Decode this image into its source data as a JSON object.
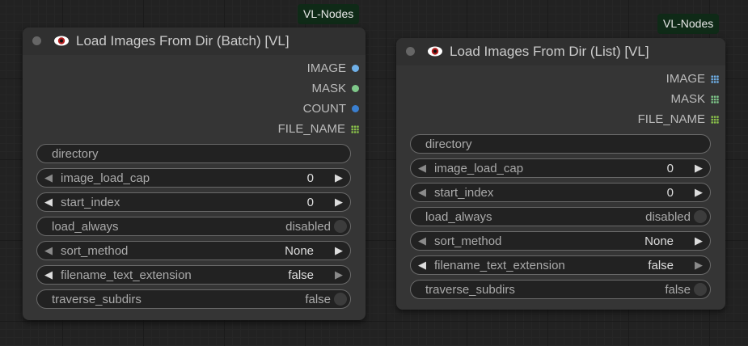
{
  "nodes": [
    {
      "badge": "VL-Nodes",
      "title": "Load Images From Dir (Batch) [VL]",
      "outputs": [
        {
          "label": "IMAGE",
          "color": "#6fb0e8",
          "shape": "circle"
        },
        {
          "label": "MASK",
          "color": "#7fc88a",
          "shape": "circle"
        },
        {
          "label": "COUNT",
          "color": "#3a7fd0",
          "shape": "circle"
        },
        {
          "label": "FILE_NAME",
          "color": "#8ac24a",
          "shape": "grid"
        }
      ],
      "widgets": {
        "directory": "directory",
        "image_load_cap": {
          "label": "image_load_cap",
          "value": "0"
        },
        "start_index": {
          "label": "start_index",
          "value": "0"
        },
        "load_always": {
          "label": "load_always",
          "value": "disabled"
        },
        "sort_method": {
          "label": "sort_method",
          "value": "None"
        },
        "filename_text_extension": {
          "label": "filename_text_extension",
          "value": "false"
        },
        "traverse_subdirs": {
          "label": "traverse_subdirs",
          "value": "false"
        }
      }
    },
    {
      "badge": "VL-Nodes",
      "title": "Load Images From Dir (List) [VL]",
      "outputs": [
        {
          "label": "IMAGE",
          "color": "#6fb0e8",
          "shape": "grid"
        },
        {
          "label": "MASK",
          "color": "#7fc88a",
          "shape": "grid"
        },
        {
          "label": "FILE_NAME",
          "color": "#8ac24a",
          "shape": "grid"
        }
      ],
      "widgets": {
        "directory": "directory",
        "image_load_cap": {
          "label": "image_load_cap",
          "value": "0"
        },
        "start_index": {
          "label": "start_index",
          "value": "0"
        },
        "load_always": {
          "label": "load_always",
          "value": "disabled"
        },
        "sort_method": {
          "label": "sort_method",
          "value": "None"
        },
        "filename_text_extension": {
          "label": "filename_text_extension",
          "value": "false"
        },
        "traverse_subdirs": {
          "label": "traverse_subdirs",
          "value": "false"
        }
      }
    }
  ]
}
